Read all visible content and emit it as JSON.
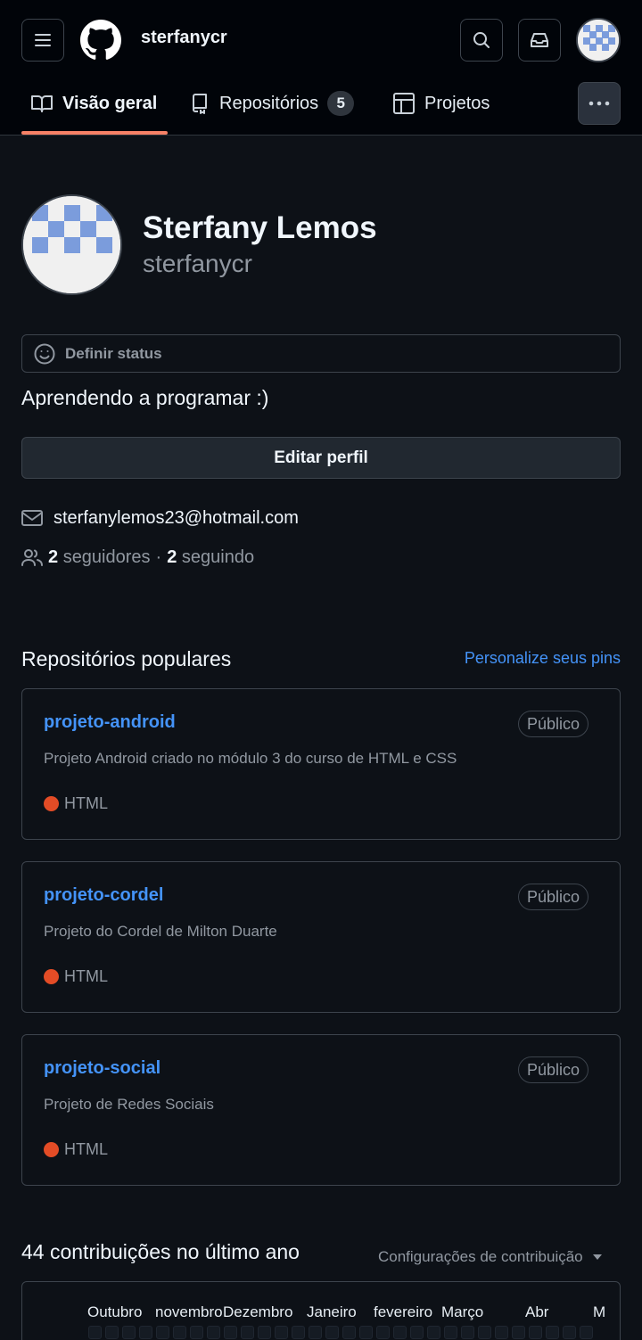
{
  "header": {
    "username": "sterfanycr",
    "icons": {
      "menu": "hamburger-icon",
      "logo": "github-logo",
      "search": "search-icon",
      "inbox": "inbox-icon"
    }
  },
  "tabs": [
    {
      "label": "Visão geral",
      "icon": "book-icon",
      "active": true
    },
    {
      "label": "Repositórios",
      "icon": "repo-icon",
      "count": "5"
    },
    {
      "label": "Projetos",
      "icon": "table-icon"
    }
  ],
  "profile": {
    "fullname": "Sterfany Lemos",
    "login": "sterfanycr",
    "status_placeholder": "Definir status",
    "bio": "Aprendendo a programar :)",
    "edit_label": "Editar perfil",
    "email": "sterfanylemos23@hotmail.com",
    "followers_count": "2",
    "followers_label": "seguidores",
    "separator": "·",
    "following_count": "2",
    "following_label": "seguindo"
  },
  "popular": {
    "title": "Repositórios populares",
    "customize_label": "Personalize seus pins",
    "repos": [
      {
        "name": "projeto-android",
        "visibility": "Público",
        "description": "Projeto Android criado no módulo 3 do curso de HTML e CSS",
        "language": "HTML",
        "language_color": "#e34c26"
      },
      {
        "name": "projeto-cordel",
        "visibility": "Público",
        "description": "Projeto do Cordel de Milton Duarte",
        "language": "HTML",
        "language_color": "#e34c26"
      },
      {
        "name": "projeto-social",
        "visibility": "Público",
        "description": "Projeto de Redes Sociais",
        "language": "HTML",
        "language_color": "#e34c26"
      }
    ]
  },
  "contributions": {
    "title": "44 contribuições no último ano",
    "settings_label": "Configurações de contribuição",
    "months": [
      "Outubro",
      "novembro",
      "Dezembro",
      "Janeiro",
      "fevereiro",
      "Março",
      "Abr",
      "M"
    ]
  },
  "colors": {
    "accent": "#f78166",
    "link": "#4493f8",
    "background": "#0d1117",
    "avatar_blue": "#7b9cdc"
  }
}
